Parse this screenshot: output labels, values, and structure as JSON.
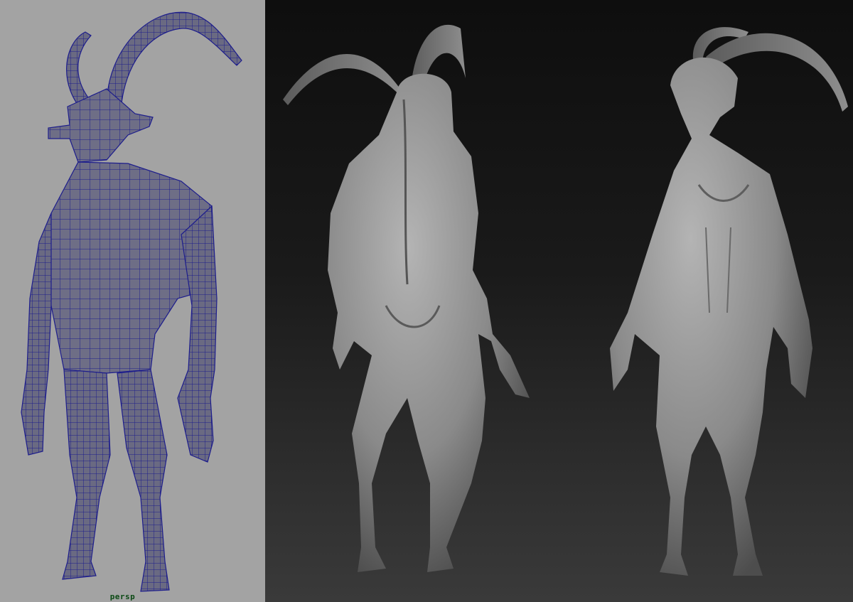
{
  "viewport": {
    "camera_label": "persp"
  },
  "panels": {
    "left": {
      "name": "wireframe-viewport",
      "background": "#a3a3a3",
      "mesh_color": "#6e6e86",
      "wire_color": "#1d1d8c"
    },
    "right": {
      "name": "sculpt-render",
      "background_top": "#0e0e0e",
      "background_bottom": "#3a3a3a",
      "surface_color": "#8a8a8a"
    }
  },
  "icons": [
    "wireframe-goat-creature",
    "sculpted-creature-back-view",
    "sculpted-creature-front-view"
  ]
}
